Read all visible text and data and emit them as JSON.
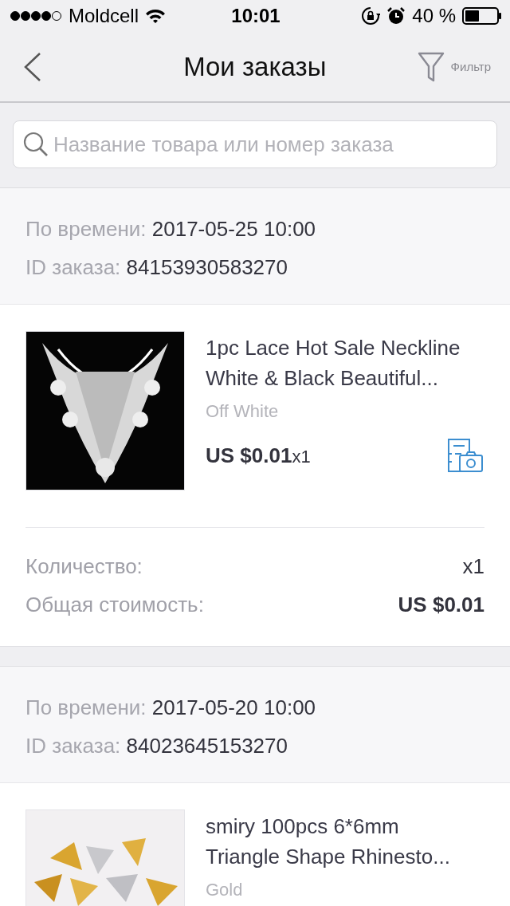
{
  "status_bar": {
    "carrier": "Moldcell",
    "time": "10:01",
    "battery": "40 %"
  },
  "nav": {
    "title": "Мои заказы",
    "filter_label": "Фильтр"
  },
  "search": {
    "placeholder": "Название товара или номер заказа"
  },
  "orders": [
    {
      "time_label": "По времени:",
      "time": "2017-05-25 10:00",
      "id_label": "ID заказа:",
      "id": "84153930583270",
      "items": [
        {
          "kind": "picture",
          "title": "1pc Lace Hot Sale Neckline White & Black  Beautiful...",
          "variant": "Off White",
          "price": "US $0.01",
          "qty": "x1"
        }
      ],
      "summary": {
        "qty_label": "Количество:",
        "qty": "x1",
        "total_label": "Общая стоимость:",
        "total": "US $0.01"
      }
    },
    {
      "time_label": "По времени:",
      "time": "2017-05-20 10:00",
      "id_label": "ID заказа:",
      "id": "84023645153270",
      "items": [
        {
          "kind": "picture",
          "title": "smiry 100pcs 6*6mm Triangle Shape Rhinesto...",
          "variant": "Gold"
        }
      ]
    }
  ]
}
